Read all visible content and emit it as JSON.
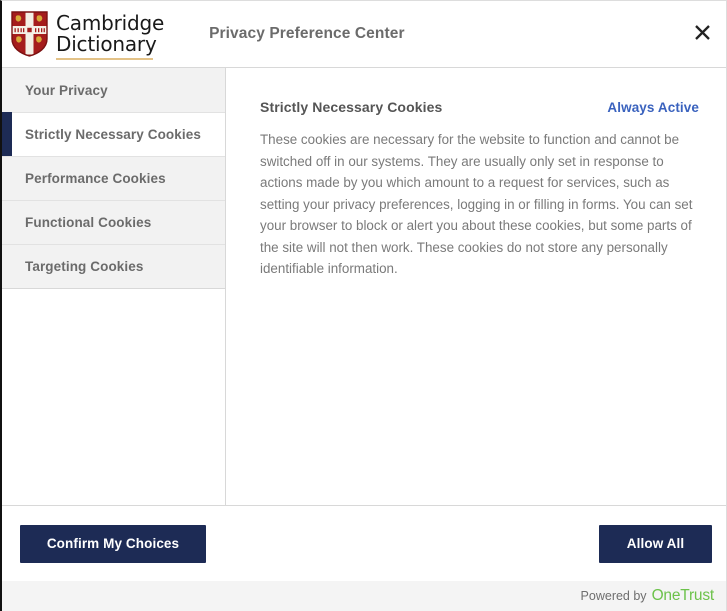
{
  "header": {
    "logo_line1": "Cambridge",
    "logo_line2": "Dictionary",
    "logo_icon": "cambridge-crest-icon",
    "title": "Privacy Preference Center",
    "close_icon": "close-icon"
  },
  "sidebar": {
    "items": [
      {
        "label": "Your Privacy",
        "active": false
      },
      {
        "label": "Strictly Necessary Cookies",
        "active": true
      },
      {
        "label": "Performance Cookies",
        "active": false
      },
      {
        "label": "Functional Cookies",
        "active": false
      },
      {
        "label": "Targeting Cookies",
        "active": false
      }
    ]
  },
  "content": {
    "title": "Strictly Necessary Cookies",
    "status": "Always Active",
    "description": "These cookies are necessary for the website to function and cannot be switched off in our systems. They are usually only set in response to actions made by you which amount to a request for services, such as setting your privacy preferences, logging in or filling in forms. You can set your browser to block or alert you about these cookies, but some parts of the site will not then work. These cookies do not store any personally identifiable information."
  },
  "footer": {
    "confirm_label": "Confirm My Choices",
    "allow_all_label": "Allow All",
    "powered_by": "Powered by",
    "brand": "OneTrust"
  },
  "colors": {
    "navy": "#1d2b55",
    "link_blue": "#3a62be",
    "onetrust_green": "#6cc24a",
    "gold_underline": "#e3c287",
    "sidebar_gray": "#f2f2f2"
  }
}
